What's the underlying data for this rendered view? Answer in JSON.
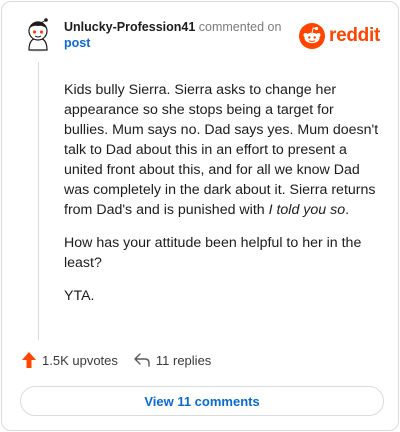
{
  "comment": {
    "author": "Unlucky-Profession41",
    "action_text": "commented on",
    "target_link": "post",
    "paragraphs": [
      {
        "text": "Kids bully Sierra. Sierra asks to change her appearance so she stops being a target for bullies. Mum says no. Dad says yes. Mum doesn't talk to Dad about this in an effort to present a united front about this, and for all we know Dad was completely in the dark about it. Sierra returns from Dad's and is punished with ",
        "emphasis": "I told you so",
        "suffix": "."
      },
      {
        "text": "How has your attitude been helpful to her in the least?"
      },
      {
        "text": "YTA."
      }
    ]
  },
  "brand": {
    "name": "reddit",
    "color": "#ff4500"
  },
  "actions": {
    "upvotes_label": "1.5K upvotes",
    "replies_label": "11 replies",
    "upvote_icon": "upvote-arrow-icon",
    "reply_icon": "reply-arrow-icon"
  },
  "view_button": {
    "label": "View 11 comments"
  },
  "colors": {
    "link": "#0a6bd4",
    "upvote": "#ff4500",
    "border": "#d9dcdf"
  }
}
